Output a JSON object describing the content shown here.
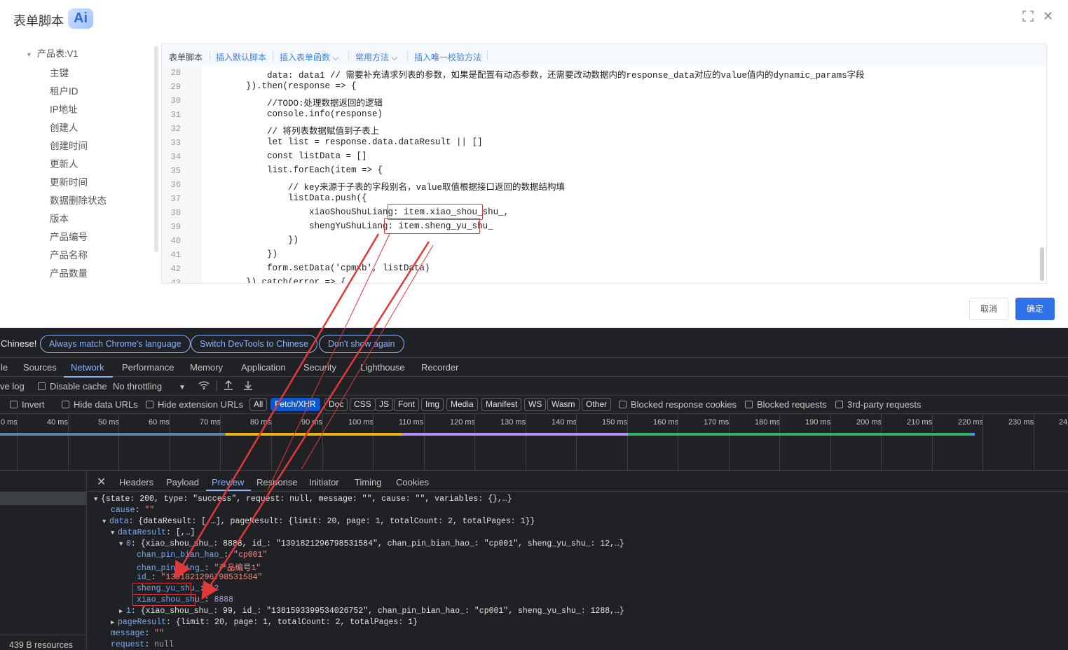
{
  "dialog": {
    "title": "表单脚本",
    "ai_badge": "Ai",
    "cancel_label": "取消",
    "ok_label": "确定"
  },
  "tree": {
    "root": "产品表:V1",
    "items": [
      "主键",
      "租户ID",
      "IP地址",
      "创建人",
      "创建时间",
      "更新人",
      "更新时间",
      "数据删除状态",
      "版本",
      "产品编号",
      "产品名称",
      "产品数量"
    ]
  },
  "editor": {
    "toolbar": {
      "title": "表单脚本",
      "items": [
        "插入默认脚本",
        "插入表单函数",
        "常用方法",
        "插入唯一校验方法"
      ]
    },
    "lines": [
      {
        "n": "28",
        "text": "            data: data1 // 需要补充请求列表的参数，如果是配置有动态参数，还需要改动数据内的response_data对应的value值内的dynamic_params字段"
      },
      {
        "n": "29",
        "text": "        }).then(response => {"
      },
      {
        "n": "30",
        "text": "            //TODO:处理数据返回的逻辑"
      },
      {
        "n": "31",
        "text": "            console.info(response)"
      },
      {
        "n": "32",
        "text": "            // 将列表数据赋值到子表上"
      },
      {
        "n": "33",
        "text": "            let list = response.data.dataResult || []"
      },
      {
        "n": "34",
        "text": "            const listData = []"
      },
      {
        "n": "35",
        "text": "            list.forEach(item => {"
      },
      {
        "n": "36",
        "text": "                // key来源于子表的字段别名，value取值根据接口返回的数据结构填"
      },
      {
        "n": "37",
        "text": "                listData.push({"
      },
      {
        "n": "38",
        "text": "                    xiaoShouShuLiang: item.xiao_shou_shu_,"
      },
      {
        "n": "39",
        "text": "                    shengYuShuLiang: item.sheng_yu_shu_"
      },
      {
        "n": "40",
        "text": "                })"
      },
      {
        "n": "41",
        "text": "            })"
      },
      {
        "n": "42",
        "text": "            form.setData('cpmxb', listData)"
      },
      {
        "n": "43",
        "text": "        }).catch(error => {"
      }
    ]
  },
  "devtools": {
    "lang_bar": {
      "text": "Chinese!",
      "buttons": [
        "Always match Chrome's language",
        "Switch DevTools to Chinese",
        "Don't show again"
      ]
    },
    "panel_tabs": [
      "le",
      "Sources",
      "Network",
      "Performance",
      "Memory",
      "Application",
      "Security",
      "Lighthouse",
      "Recorder"
    ],
    "active_panel": "Network",
    "toolbar1": {
      "preserve_log": "ve log",
      "disable_cache": "Disable cache",
      "throttling": "No throttling"
    },
    "toolbar2": {
      "invert": "Invert",
      "hide_data_urls": "Hide data URLs",
      "hide_ext_urls": "Hide extension URLs",
      "filters": [
        "All",
        "Fetch/XHR",
        "Doc",
        "CSS",
        "JS",
        "Font",
        "Img",
        "Media",
        "Manifest",
        "WS",
        "Wasm",
        "Other"
      ],
      "selected_filter": "Fetch/XHR",
      "blocked_cookies": "Blocked response cookies",
      "blocked_requests": "Blocked requests",
      "third_party": "3rd-party requests"
    },
    "timeline_ticks": [
      "0 ms",
      "40 ms",
      "50 ms",
      "60 ms",
      "70 ms",
      "80 ms",
      "90 ms",
      "100 ms",
      "110 ms",
      "120 ms",
      "130 ms",
      "140 ms",
      "150 ms",
      "160 ms",
      "170 ms",
      "180 ms",
      "190 ms",
      "200 ms",
      "210 ms",
      "220 ms",
      "230 ms",
      "24"
    ],
    "status": "439 B resources",
    "detail_tabs": [
      "Headers",
      "Payload",
      "Preview",
      "Response",
      "Initiator",
      "Timing",
      "Cookies"
    ],
    "active_detail_tab": "Preview",
    "preview": {
      "root": "{state: 200, type: \"success\", request: null, message: \"\", cause: \"\", variables: {},…}",
      "cause_key": "cause",
      "cause_val": "\"\"",
      "data_key": "data",
      "data_summary": "{dataResult: [,…], pageResult: {limit: 20, page: 1, totalCount: 2, totalPages: 1}}",
      "dataResult_key": "dataResult",
      "dataResult_summary": "[,…]",
      "item0_key": "0",
      "item0_summary": "{xiao_shou_shu_: 8888, id_: \"1391821296798531584\", chan_pin_bian_hao_: \"cp001\", sheng_yu_shu_: 12,…}",
      "f1_key": "chan_pin_bian_hao_",
      "f1_val": "\"cp001\"",
      "f2_key": "chan_pin_ming_",
      "f2_val": "\"产品编号1\"",
      "f3_key": "id_",
      "f3_val": "\"1391821296798531584\"",
      "f4_key": "sheng_yu_shu_",
      "f4_val": "12",
      "f5_key": "xiao_shou_shu_",
      "f5_val": "8888",
      "item1_key": "1",
      "item1_summary": "{xiao_shou_shu_: 99, id_: \"1381593399534026752\", chan_pin_bian_hao_: \"cp001\", sheng_yu_shu_: 1288,…}",
      "pageResult_key": "pageResult",
      "pageResult_summary": "{limit: 20, page: 1, totalCount: 2, totalPages: 1}",
      "message_key": "message",
      "message_val": "\"\"",
      "request_key": "request",
      "request_val": "null"
    }
  },
  "colors": {
    "accent": "#2f6fe8",
    "annotation_red": "#e0393b",
    "devtools_bg": "#202124",
    "link_blue": "#8ab4f8"
  }
}
